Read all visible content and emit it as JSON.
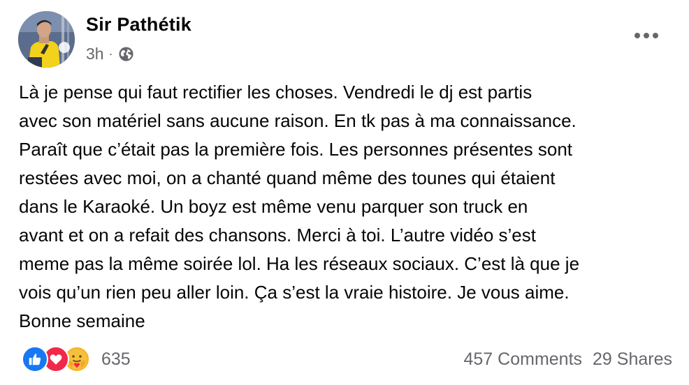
{
  "post": {
    "author": "Sir Pathétik",
    "time": "3h",
    "separator": "·",
    "privacy_icon": "globe-icon",
    "more_icon": "more-horizontal-icon",
    "text": "Là je pense qui faut rectifier les choses. Vendredi le dj est partis\navec son matériel sans aucune raison. En tk pas à ma connaissance.\nParaît que c’était pas la première fois. Les personnes présentes sont\nrestées avec moi, on a chanté quand même des tounes qui étaient\ndans le Karaoké. Un boyz est même venu parquer son truck en\navant et on a refait des chansons. Merci à toi. L’autre vidéo s’est\nmeme pas la même soirée lol. Ha les réseaux sociaux. C’est là que je\nvois qu’un rien peu aller loin. Ça s’est la vraie histoire. Je vous aime.\nBonne semaine"
  },
  "footer": {
    "reaction_icons": [
      "like-icon",
      "love-icon",
      "care-icon"
    ],
    "reaction_count": "635",
    "comments": "457 Comments",
    "shares": "29 Shares"
  },
  "colors": {
    "like": "#1877f2",
    "love": "#f02849",
    "care": "#f7b125",
    "secondary_text": "#65676b",
    "primary_text": "#050505"
  }
}
